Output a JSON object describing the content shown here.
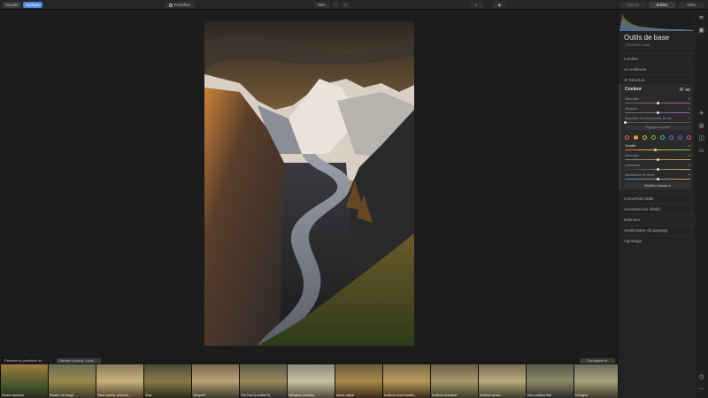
{
  "topbar": {
    "cancel_label": "Annuler",
    "apply_label": "Appliquer",
    "presets_label": "Prédéfinis",
    "zoom_label": "95%",
    "zoom_minus": "–",
    "zoom_plus": "+",
    "favorites_label": "Favoris",
    "edit_label": "Édition",
    "info_label": "Infos"
  },
  "panel": {
    "title": "Outils de base",
    "file_name": "_DSC9635-1.psb",
    "sections_top": [
      "Lumière",
      "AI Améliorée",
      "AI Structure"
    ],
    "couleur": {
      "title": "Couleur",
      "sliders": [
        {
          "label": "Saturation",
          "value": "0",
          "pos": 0.5
        },
        {
          "label": "Vibrance",
          "value": "0",
          "pos": 0.5
        },
        {
          "label": "Supprimer les dominantes de cou",
          "value": "0",
          "pos": 0.0
        }
      ],
      "advanced_label": "Réglages avancés",
      "hsl_sliders": [
        {
          "label": "Tonalité",
          "value": "-4",
          "pos": 0.46
        },
        {
          "label": "Saturation",
          "value": "0",
          "pos": 0.5
        },
        {
          "label": "Luminance",
          "value": "0",
          "pos": 0.5
        },
        {
          "label": "Modification de teinte",
          "value": "0",
          "pos": 0.5
        }
      ],
      "mask_label": "Modifier masque ▾"
    },
    "sections_bottom": [
      "Conversion N&B",
      "Accentuer les détails",
      "Débruiter",
      "Amélioration de paysage",
      "Vignetage"
    ]
  },
  "presets_bar": {
    "tab_luminar": "Paramètres prédéfinis de Luminar",
    "tab_ultimate": "Ultimate Luminar Looks",
    "save_label": "Enregistrer le nouveau"
  },
  "filmstrip": [
    "Forest structure",
    "Refaire 3e image",
    "Paris sunrise (amendi...",
    "Soar",
    "Tempest",
    "The End (Lumibar 6)",
    "Whispers (cmdes)",
    "almos adjust",
    "bedlend circuit betaki...",
    "bedlend circuitbdt",
    "bedlend circuit...",
    "brex outilous lfed",
    "bretagne"
  ],
  "colors": {
    "accent": "#4a86e0",
    "swatches": [
      "#e06a4a",
      "#e0a040",
      "#d9c94a",
      "#6ac24a",
      "#4ac0b5",
      "#4a7ee0",
      "#8a4ae0",
      "#d04ac0"
    ]
  }
}
